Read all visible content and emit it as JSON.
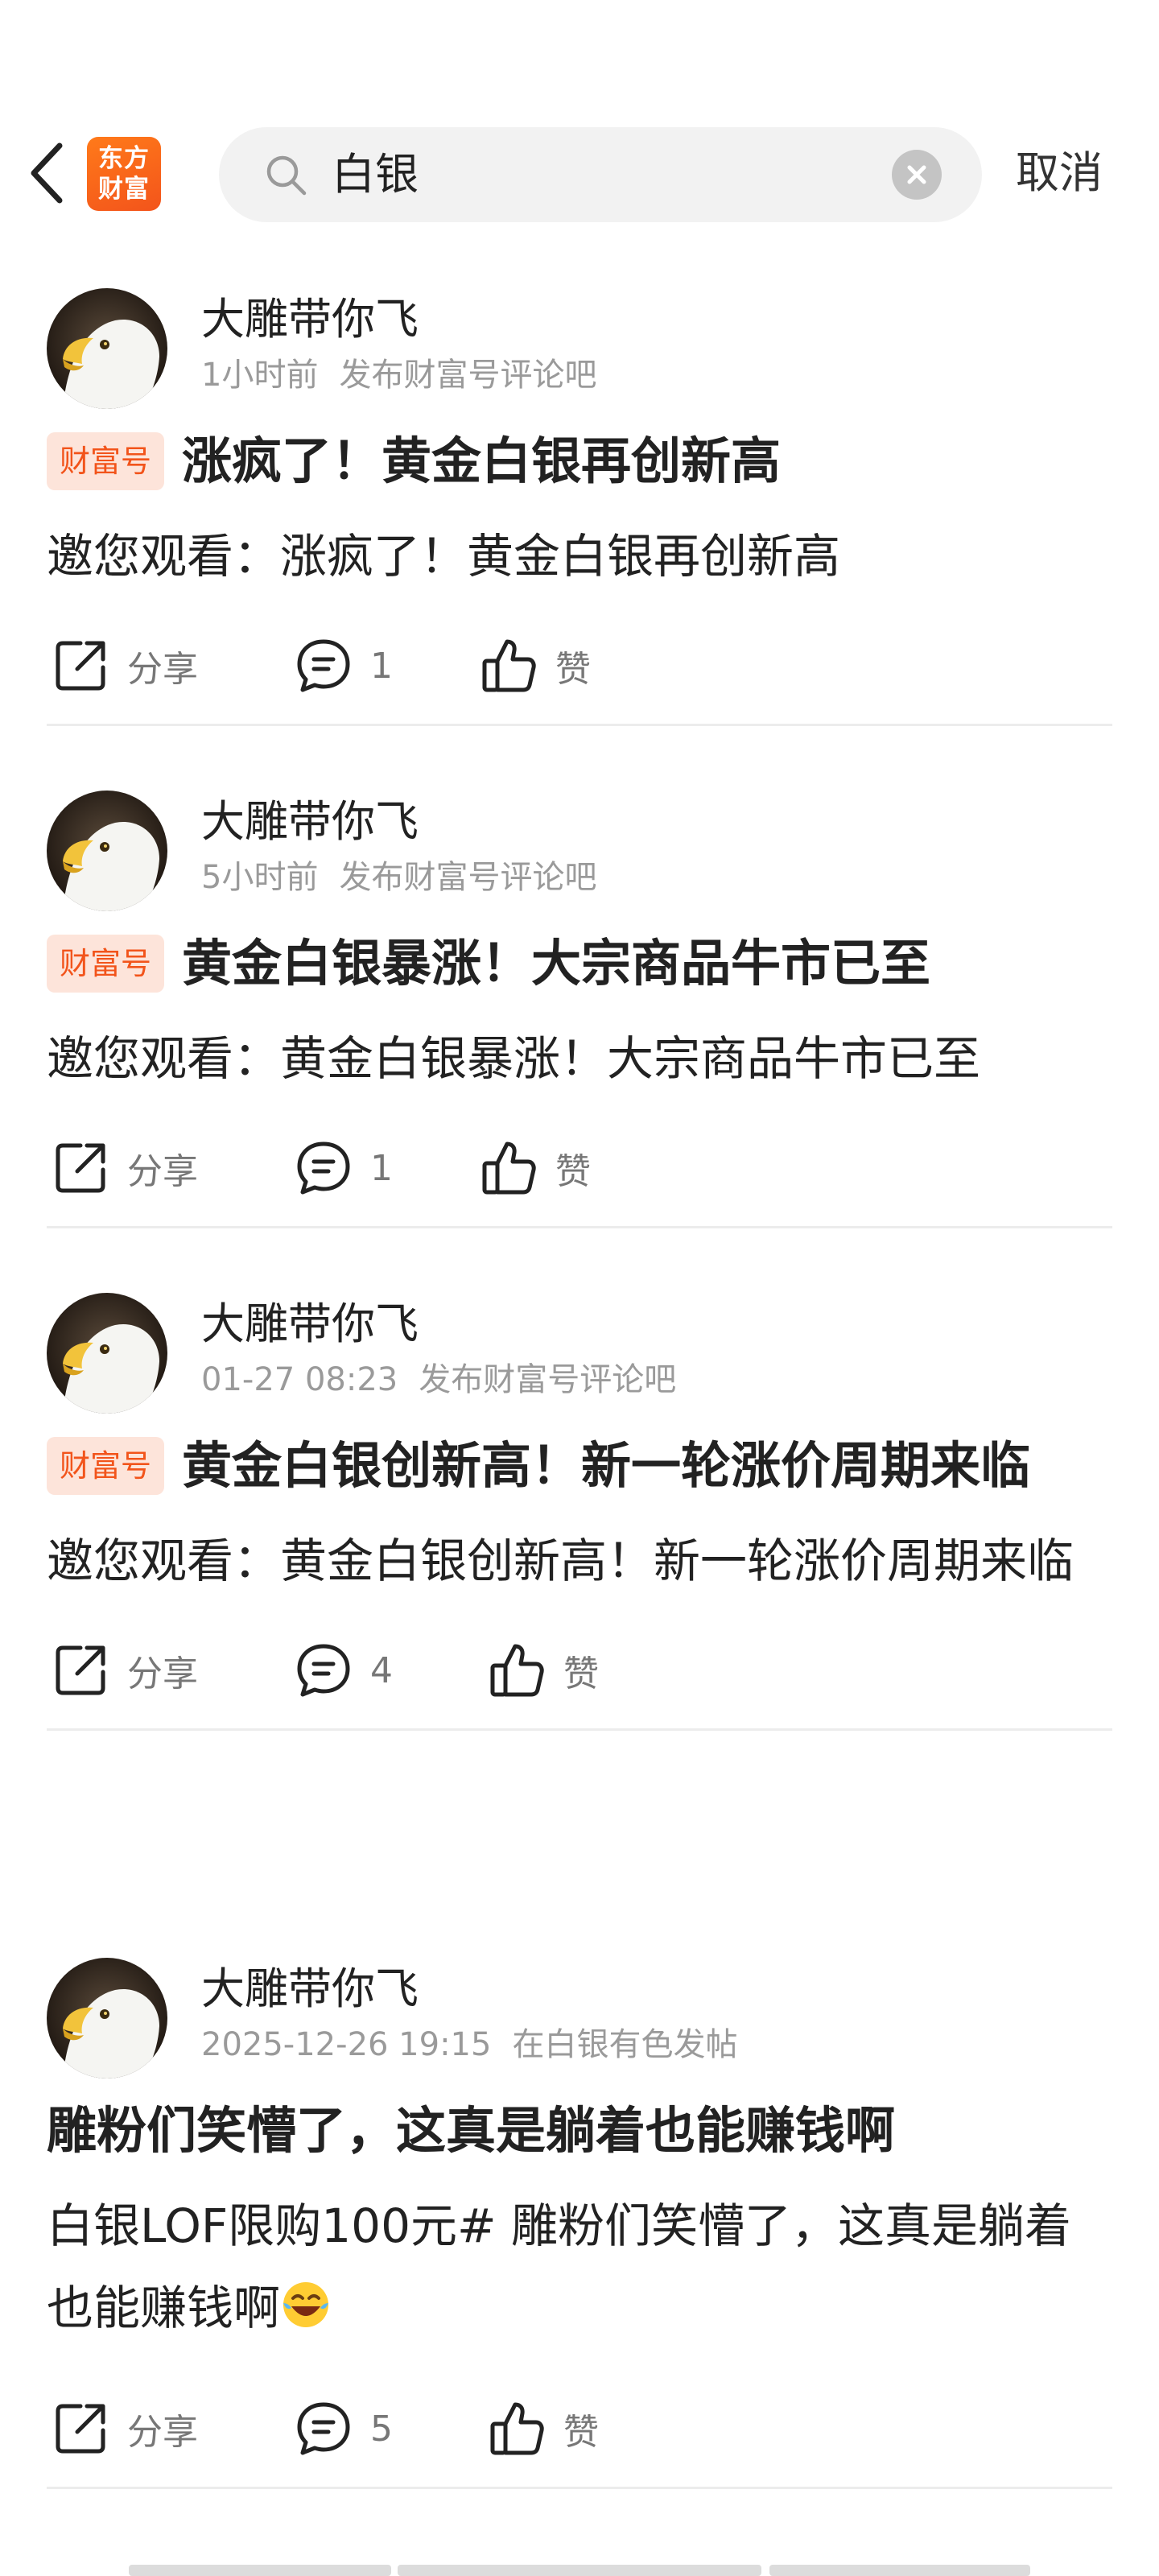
{
  "search": {
    "value": "白银",
    "cancel_label": "取消"
  },
  "app": {
    "logo_line1": "东方",
    "logo_line2": "财富"
  },
  "posts": [
    {
      "author": "大雕带你飞",
      "time": "1小时前",
      "source": "发布财富号评论吧",
      "tag": "财富号",
      "title": "涨疯了！黄金白银再创新高",
      "body": "邀您观看：涨疯了！黄金白银再创新高",
      "share_label": "分享",
      "comment_count": "1",
      "like_label": "赞"
    },
    {
      "author": "大雕带你飞",
      "time": "5小时前",
      "source": "发布财富号评论吧",
      "tag": "财富号",
      "title": "黄金白银暴涨！大宗商品牛市已至",
      "body": "邀您观看：黄金白银暴涨！大宗商品牛市已至",
      "share_label": "分享",
      "comment_count": "1",
      "like_label": "赞"
    },
    {
      "author": "大雕带你飞",
      "time": "01-27 08:23",
      "source": "发布财富号评论吧",
      "tag": "财富号",
      "title": "黄金白银创新高！新一轮涨价周期来临",
      "body": "邀您观看：黄金白银创新高！新一轮涨价周期来临",
      "share_label": "分享",
      "comment_count": "4",
      "like_label": "赞"
    },
    {
      "author": "大雕带你飞",
      "time": "2025-12-26 19:15",
      "source": "在白银有色发帖",
      "title": "雕粉们笑懵了，这真是躺着也能赚钱啊",
      "body": "白银LOF限购100元# 雕粉们笑懵了，这真是躺着也能赚钱啊",
      "share_label": "分享",
      "comment_count": "5",
      "like_label": "赞"
    }
  ],
  "icons": [
    "back-arrow-icon",
    "search-icon",
    "clear-icon",
    "share-icon",
    "comment-icon",
    "like-icon",
    "laughing-emoji-icon"
  ],
  "colors": {
    "brand_orange": "#f2541b",
    "tag_bg": "#fde4da",
    "meta_gray": "#9a9a9a",
    "search_bg": "#f2f2f2"
  }
}
